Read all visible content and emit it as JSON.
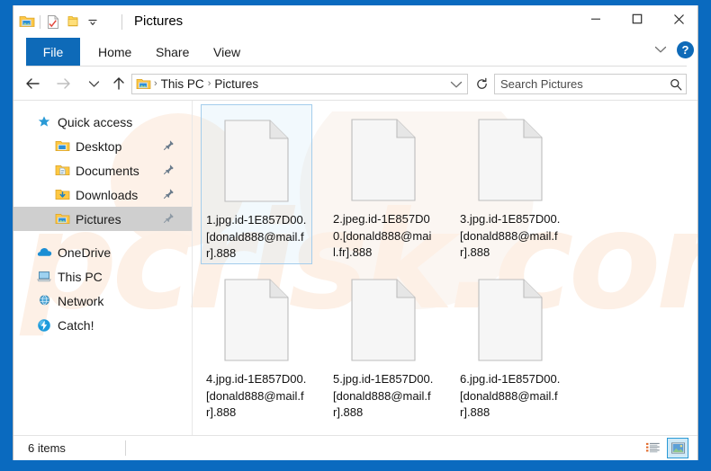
{
  "window": {
    "title": "Pictures",
    "quick_access_toolbar": [
      {
        "name": "explorer-icon",
        "label": "Pictures folder"
      },
      {
        "name": "properties-icon",
        "label": "Properties"
      },
      {
        "name": "new-folder-icon",
        "label": "New folder"
      },
      {
        "name": "customize-chevron-icon",
        "label": "Customize Quick Access Toolbar"
      }
    ],
    "controls": {
      "minimize": "─",
      "maximize": "☐",
      "close": "✕"
    }
  },
  "ribbon": {
    "tabs": [
      {
        "label": "File",
        "active": true
      },
      {
        "label": "Home",
        "active": false
      },
      {
        "label": "Share",
        "active": false
      },
      {
        "label": "View",
        "active": false
      }
    ],
    "collapse_label": "⌄",
    "help_label": "?"
  },
  "navigation": {
    "back_label": "←",
    "forward_label": "→",
    "recent_label": "⌄",
    "up_label": "↑",
    "breadcrumbs": [
      "This PC",
      "Pictures"
    ],
    "separator": "›",
    "refresh_label": "↻"
  },
  "search": {
    "placeholder": "Search Pictures",
    "value": ""
  },
  "sidebar": {
    "items": [
      {
        "label": "Quick access",
        "icon": "star-icon",
        "level": 0,
        "pinned": false,
        "selected": false
      },
      {
        "label": "Desktop",
        "icon": "folder-desktop-icon",
        "level": 1,
        "pinned": true,
        "selected": false
      },
      {
        "label": "Documents",
        "icon": "folder-documents-icon",
        "level": 1,
        "pinned": true,
        "selected": false
      },
      {
        "label": "Downloads",
        "icon": "folder-downloads-icon",
        "level": 1,
        "pinned": true,
        "selected": false
      },
      {
        "label": "Pictures",
        "icon": "folder-pictures-icon",
        "level": 1,
        "pinned": true,
        "selected": true
      },
      {
        "label": "OneDrive",
        "icon": "onedrive-icon",
        "level": 0,
        "pinned": false,
        "selected": false
      },
      {
        "label": "This PC",
        "icon": "thispc-icon",
        "level": 0,
        "pinned": false,
        "selected": false
      },
      {
        "label": "Network",
        "icon": "network-icon",
        "level": 0,
        "pinned": false,
        "selected": false
      },
      {
        "label": "Catch!",
        "icon": "catch-icon",
        "level": 0,
        "pinned": false,
        "selected": false
      }
    ]
  },
  "files": [
    {
      "name": "1.jpg.id-1E857D00.[donald888@mail.fr].888",
      "icon": "blank-document-icon",
      "selected": true
    },
    {
      "name": "2.jpeg.id-1E857D00.[donald888@mail.fr].888",
      "icon": "blank-document-icon",
      "selected": false
    },
    {
      "name": "3.jpg.id-1E857D00.[donald888@mail.fr].888",
      "icon": "blank-document-icon",
      "selected": false
    },
    {
      "name": "4.jpg.id-1E857D00.[donald888@mail.fr].888",
      "icon": "blank-document-icon",
      "selected": false
    },
    {
      "name": "5.jpg.id-1E857D00.[donald888@mail.fr].888",
      "icon": "blank-document-icon",
      "selected": false
    },
    {
      "name": "6.jpg.id-1E857D00.[donald888@mail.fr].888",
      "icon": "blank-document-icon",
      "selected": false
    }
  ],
  "status": {
    "item_count": "6 items",
    "views": [
      {
        "name": "details-view-button",
        "active": false
      },
      {
        "name": "large-icons-view-button",
        "active": true
      }
    ]
  },
  "watermark": {
    "text": "pcrisk.com"
  },
  "colors": {
    "window_frame": "#0a6abf",
    "accent": "#0e6ab8",
    "selection_border": "#a4cdec",
    "sidebar_selected": "#cfcfcf",
    "watermark": "#fdf0e6"
  }
}
